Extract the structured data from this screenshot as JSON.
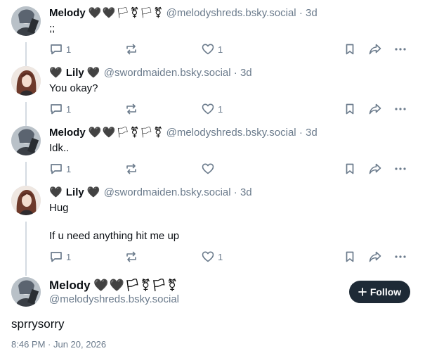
{
  "posts": [
    {
      "name": "Melody",
      "flair": "🖤🖤🏳⚧🏳⚧",
      "handle": "@melodyshreds.bsky.social",
      "sep": "·",
      "time": "3d",
      "lines": [
        ";;"
      ],
      "reply_count": "1",
      "like_count": "1",
      "avatar": "melody"
    },
    {
      "name": "Lily",
      "flair_before": "🖤",
      "flair": "🖤",
      "handle": "@swordmaiden.bsky.social",
      "sep": "·",
      "time": "3d",
      "lines": [
        "You okay?"
      ],
      "reply_count": "1",
      "like_count": "1",
      "avatar": "lily"
    },
    {
      "name": "Melody",
      "flair": "🖤🖤🏳⚧🏳⚧",
      "handle": "@melodyshreds.bsky.social",
      "sep": "·",
      "time": "3d",
      "lines": [
        "Idk.."
      ],
      "reply_count": "1",
      "like_count": "",
      "avatar": "melody"
    },
    {
      "name": "Lily",
      "flair_before": "🖤",
      "flair": "🖤",
      "handle": "@swordmaiden.bsky.social",
      "sep": "·",
      "time": "3d",
      "lines": [
        "Hug",
        "If u need anything hit me up"
      ],
      "reply_count": "1",
      "like_count": "1",
      "avatar": "lily"
    }
  ],
  "main_post": {
    "name": "Melody",
    "flair": "🖤🖤🏳⚧🏳⚧",
    "handle": "@melodyshreds.bsky.social",
    "follow_label": "Follow",
    "text": "sprrysorry",
    "date": "8:46 PM · Jun 20, 2026"
  },
  "colors": {
    "muted": "#6b7b8c",
    "follow_bg": "#1e2a36",
    "thread_line": "#d4dbe2"
  },
  "icons": [
    "reply-icon",
    "repost-icon",
    "like-icon",
    "bookmark-icon",
    "share-icon",
    "more-icon",
    "plus-icon",
    "heart-icon",
    "trans-flag-icon"
  ]
}
